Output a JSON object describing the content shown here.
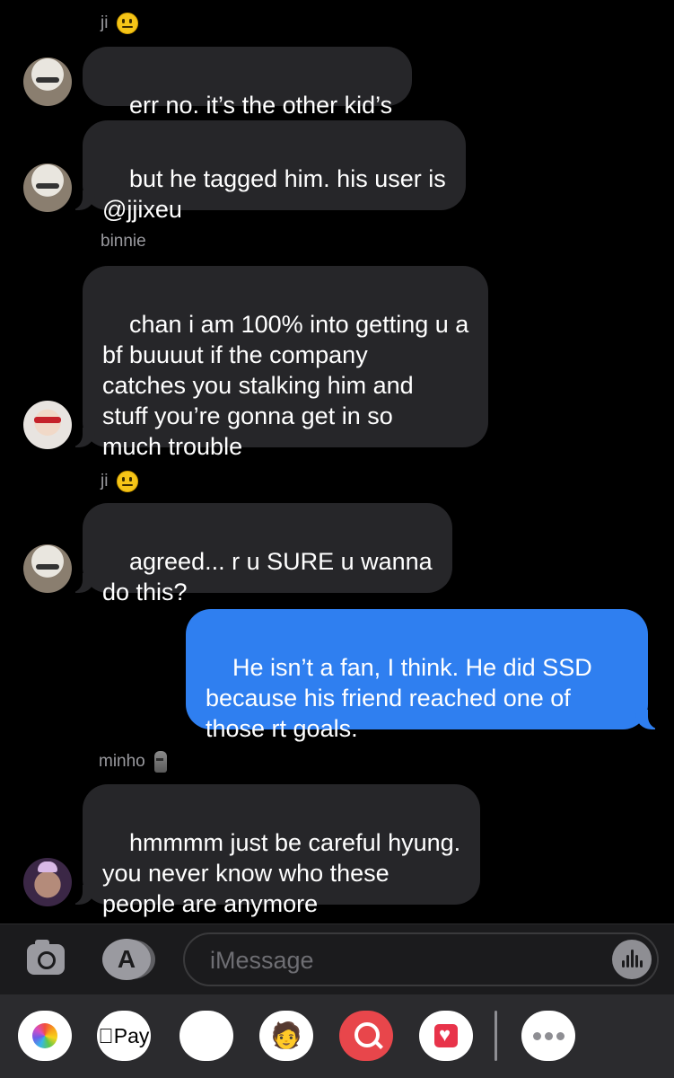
{
  "conversation": {
    "groups": [
      {
        "sender": "ji",
        "sender_emoji": "neutral-face",
        "messages": [
          "err no. it’s the other kid’s",
          "but he tagged him. his user is\n@jjixeu"
        ]
      },
      {
        "sender": "binnie",
        "messages": [
          "chan i am 100% into getting u a\nbf buuuut if the company\ncatches you stalking him and\nstuff you’re gonna get in so\nmuch trouble"
        ]
      },
      {
        "sender": "ji",
        "sender_emoji": "neutral-face",
        "messages": [
          "agreed... r u SURE u wanna\ndo this?"
        ]
      },
      {
        "sender": "me",
        "messages": [
          "He isn’t a fan, I think. He did SSD\nbecause his friend reached one of\nthose rt goals."
        ]
      },
      {
        "sender": "minho",
        "sender_emoji": "moai",
        "messages": [
          "hmmmm just be careful hyung.\nyou never know who these\npeople are anymore"
        ]
      }
    ]
  },
  "input_bar": {
    "placeholder": "iMessage",
    "camera_icon": "camera-icon",
    "appstore_icon": "app-store-icon",
    "audio_icon": "audio-waveform-icon"
  },
  "app_tray": {
    "apple_pay_label": "Pay",
    "items": [
      "photos-icon",
      "apple-pay-icon",
      "animoji-icon",
      "memoji-icon",
      "image-search-icon",
      "heart-app-icon",
      "more-icon"
    ]
  },
  "colors": {
    "incoming_bubble": "#262629",
    "outgoing_bubble": "#2f7ff0",
    "background": "#000000"
  }
}
